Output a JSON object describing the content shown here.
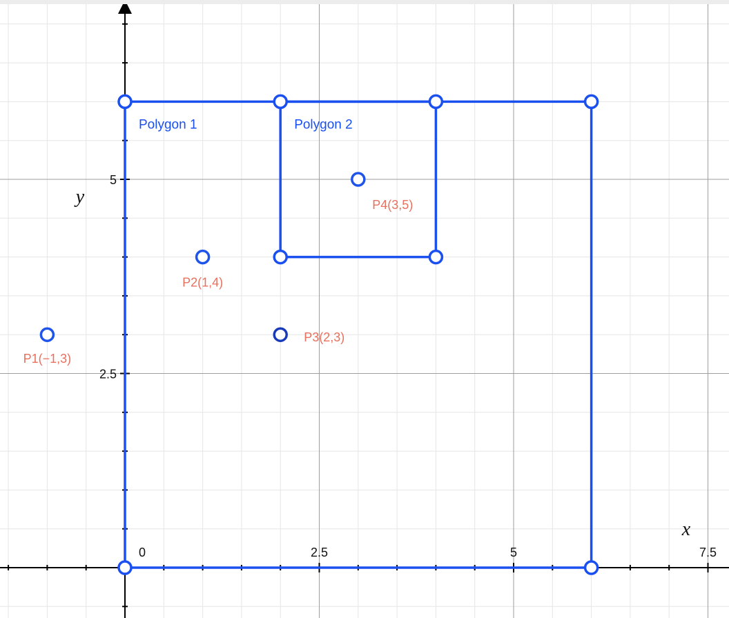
{
  "chart_data": {
    "type": "scatter",
    "xlabel": "x",
    "ylabel": "y",
    "xlim": [
      -1.6,
      7.75
    ],
    "ylim": [
      -0.6,
      7.3
    ],
    "grid": true,
    "x_ticks": [
      {
        "value": 0,
        "label": "0"
      },
      {
        "value": 2.5,
        "label": "2.5"
      },
      {
        "value": 5,
        "label": "5"
      },
      {
        "value": 7.5,
        "label": "7.5"
      }
    ],
    "y_ticks": [
      {
        "value": 2.5,
        "label": "2.5"
      },
      {
        "value": 5,
        "label": "5"
      }
    ],
    "polygons": [
      {
        "name": "Polygon 1",
        "vertices": [
          [
            0,
            0
          ],
          [
            0,
            6
          ],
          [
            2,
            6
          ],
          [
            4,
            6
          ],
          [
            6,
            6
          ],
          [
            6,
            0
          ]
        ]
      },
      {
        "name": "Polygon 2",
        "vertices": [
          [
            2,
            6
          ],
          [
            2,
            4
          ],
          [
            4,
            4
          ],
          [
            4,
            6
          ]
        ]
      }
    ],
    "points": [
      {
        "label": "P1(−1,3)",
        "x": -1,
        "y": 3
      },
      {
        "label": "P2(1,4)",
        "x": 1,
        "y": 4
      },
      {
        "label": "P3(2,3)",
        "x": 2,
        "y": 3
      },
      {
        "label": "P4(3,5)",
        "x": 3,
        "y": 5
      }
    ]
  },
  "colors": {
    "polygon": "#1a4ff0",
    "point_outline": "#1e54ea",
    "point_outline_dark": "#1a3bb8",
    "point_label": "#e8705e",
    "grid_minor": "#e5e5e5",
    "grid_major": "#9e9e9e",
    "axis": "#000000"
  }
}
